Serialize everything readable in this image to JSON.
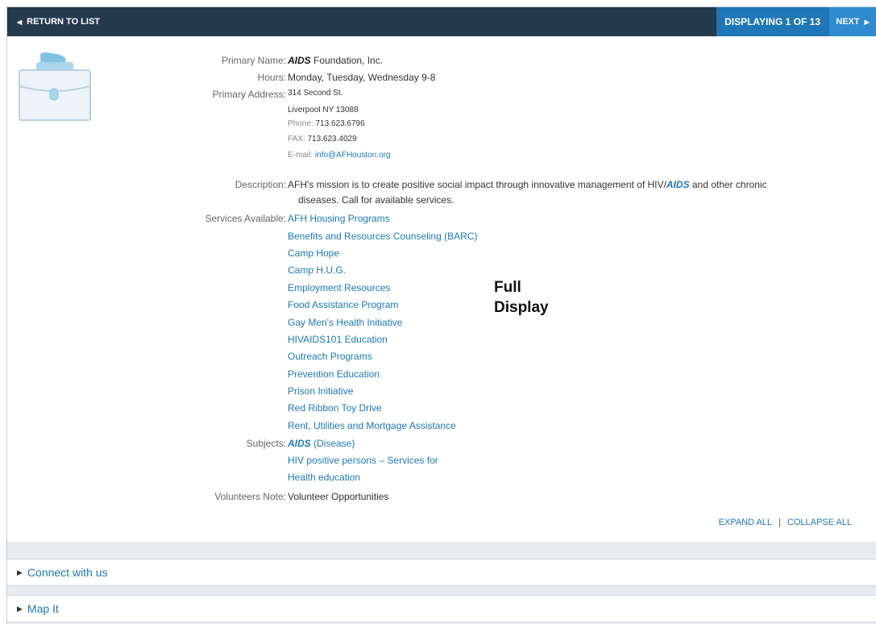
{
  "topbar": {
    "return_label": "RETURN TO LIST",
    "display_label": "DISPLAYING 1 OF 13",
    "next_label": "NEXT"
  },
  "record": {
    "icon": "briefcase-icon",
    "primary_name_label": "Primary Name:",
    "primary_name_em": "AIDS",
    "primary_name_rest": " Foundation, Inc.",
    "hours_label": "Hours:",
    "hours": "Monday, Tuesday, Wednesday 9-8",
    "address_label": "Primary Address:",
    "address_line1": "314 Second St.",
    "address_line2": "Liverpool NY 13088",
    "phone_label": "Phone:",
    "phone": "713.623.6796",
    "fax_label": "FAX:",
    "fax": "713.623.4029",
    "email_label": "E-mail:",
    "email": "info@AFHouston.org",
    "description_label": "Description:",
    "description_part1": "AFH's mission is to create positive social impact through innovative management of HIV/",
    "description_em": "AIDS",
    "description_part2": " and other chronic",
    "description_line2": "diseases. Call for available services.",
    "services_label": "Services Available:",
    "services": [
      "AFH Housing Programs",
      "Benefits and Resources Counseling (BARC)",
      "Camp Hope",
      "Camp H.U.G.",
      "Employment Resources",
      "Food Assistance Program",
      "Gay Men's Health Initiative",
      "HIVAIDS101 Education",
      "Outreach Programs",
      "Prevention Education",
      "Prison Initiative",
      "Red Ribbon Toy Drive",
      "Rent, Utilities and Mortgage Assistance"
    ],
    "subjects_label": "Subjects:",
    "subject1_em": "AIDS",
    "subject1_rest": " (Disease)",
    "subject2": "HIV positive persons – Services for",
    "subject3": "Health education",
    "volunteers_label": "Volunteers Note:",
    "volunteers": "Volunteer Opportunities"
  },
  "annotation": {
    "line1": "Full",
    "line2": "Display"
  },
  "actions": {
    "expand_all": "EXPAND ALL",
    "separator": "|",
    "collapse_all": "COLLAPSE ALL"
  },
  "panels": {
    "connect": "Connect with us",
    "map": "Map It"
  },
  "colors": {
    "topbar": "#263a4d",
    "display_box": "#1f77b7",
    "next_button": "#2f8bd0",
    "link": "#1f77b7"
  }
}
